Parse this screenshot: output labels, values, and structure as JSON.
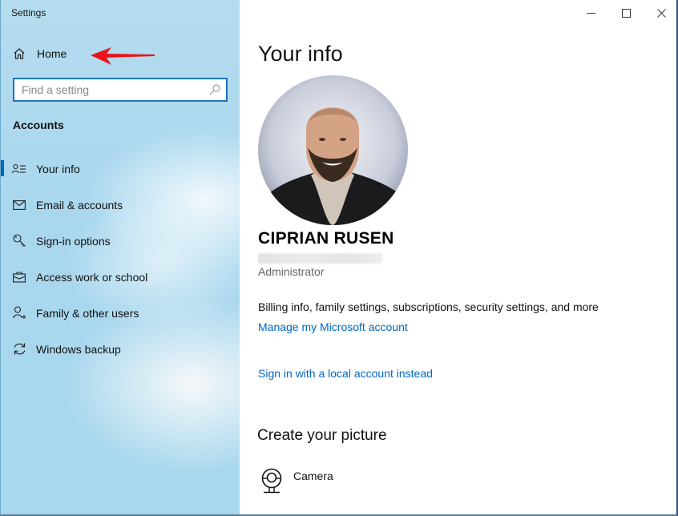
{
  "window": {
    "title": "Settings",
    "controls": {
      "minimize": "minimize",
      "maximize": "maximize",
      "close": "close"
    }
  },
  "sidebar": {
    "home_label": "Home",
    "search_placeholder": "Find a setting",
    "section_title": "Accounts",
    "items": [
      {
        "label": "Your info",
        "icon": "person-list-icon",
        "selected": true
      },
      {
        "label": "Email & accounts",
        "icon": "mail-icon",
        "selected": false
      },
      {
        "label": "Sign-in options",
        "icon": "key-icon",
        "selected": false
      },
      {
        "label": "Access work or school",
        "icon": "briefcase-icon",
        "selected": false
      },
      {
        "label": "Family & other users",
        "icon": "person-add-icon",
        "selected": false
      },
      {
        "label": "Windows backup",
        "icon": "sync-icon",
        "selected": false
      }
    ]
  },
  "main": {
    "page_title": "Your info",
    "user_name": "CIPRIAN RUSEN",
    "role": "Administrator",
    "billing_text": "Billing info, family settings, subscriptions, security settings, and more",
    "manage_link": "Manage my Microsoft account",
    "local_account_link": "Sign in with a local account instead",
    "create_picture_title": "Create your picture",
    "camera_label": "Camera"
  },
  "colors": {
    "accent": "#0067c0",
    "search_border": "#1a73c9",
    "annotation_arrow": "#e8141b"
  }
}
